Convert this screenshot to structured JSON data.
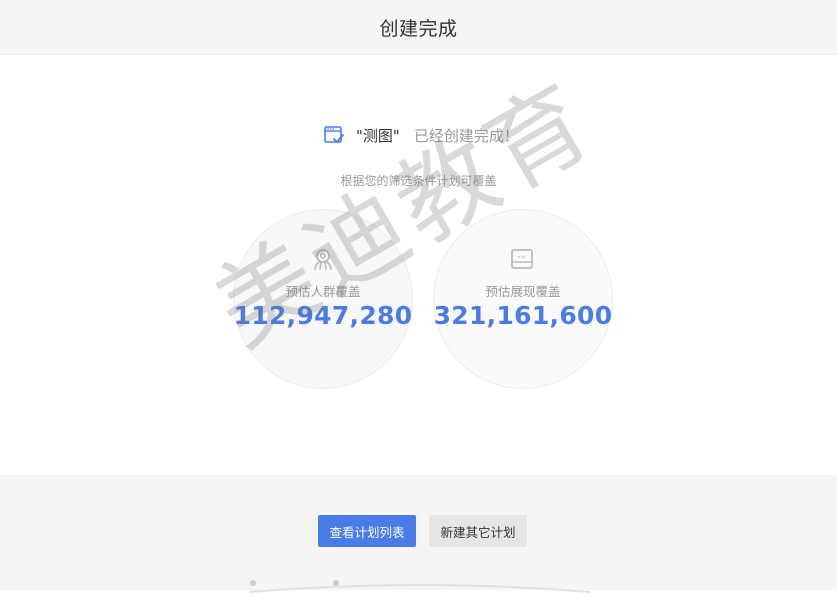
{
  "header": {
    "title": "创建完成"
  },
  "success": {
    "plan_name": "\"测图\"",
    "message": "已经创建完成！",
    "subtitle": "根据您的筛选条件计划可覆盖"
  },
  "metrics": [
    {
      "icon": "audience-icon",
      "label": "预估人群覆盖",
      "value": "112,947,280"
    },
    {
      "icon": "impression-icon",
      "label": "预估展现覆盖",
      "value": "321,161,600"
    }
  ],
  "actions": {
    "primary_label": "查看计划列表",
    "secondary_label": "新建其它计划"
  },
  "watermark": "美迪教育",
  "colors": {
    "accent": "#4a7ce8",
    "header_bg": "#f5f5f5",
    "footer_bg": "#f5f5f5"
  }
}
